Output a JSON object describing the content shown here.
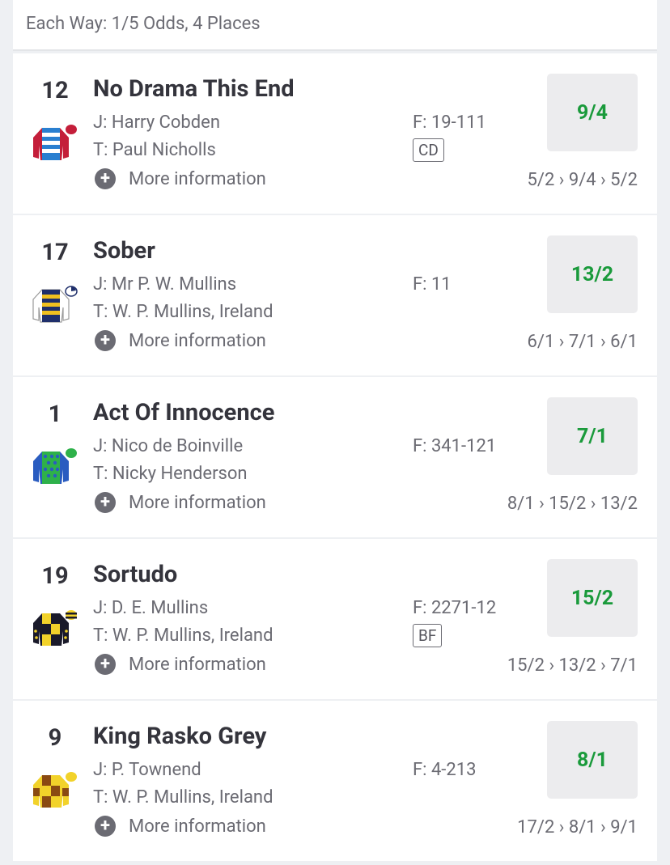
{
  "header": {
    "text": "Each Way: 1/5 Odds, 4 Places"
  },
  "runners": [
    {
      "number": "12",
      "name": "No Drama This End",
      "jockey": "J: Harry Cobden",
      "trainer": "T: Paul Nicholls",
      "form": "F: 19-111",
      "tag": "CD",
      "more": "More information",
      "odds": "9/4",
      "movement": "5/2 › 9/4 › 5/2"
    },
    {
      "number": "17",
      "name": "Sober",
      "jockey": "J: Mr P. W. Mullins",
      "trainer": "T: W. P. Mullins, Ireland",
      "form": "F: 11",
      "tag": "",
      "more": "More information",
      "odds": "13/2",
      "movement": "6/1 › 7/1 › 6/1"
    },
    {
      "number": "1",
      "name": "Act Of Innocence",
      "jockey": "J: Nico de Boinville",
      "trainer": "T: Nicky Henderson",
      "form": "F: 341-121",
      "tag": "",
      "more": "More information",
      "odds": "7/1",
      "movement": "8/1 › 15/2 › 13/2"
    },
    {
      "number": "19",
      "name": "Sortudo",
      "jockey": "J: D. E. Mullins",
      "trainer": "T: W. P. Mullins, Ireland",
      "form": "F: 2271-12",
      "tag": "BF",
      "more": "More information",
      "odds": "15/2",
      "movement": "15/2 › 13/2 › 7/1"
    },
    {
      "number": "9",
      "name": "King Rasko Grey",
      "jockey": "J: P. Townend",
      "trainer": "T: W. P. Mullins, Ireland",
      "form": "F: 4-213",
      "tag": "",
      "more": "More information",
      "odds": "8/1",
      "movement": "17/2 › 8/1 › 9/1"
    }
  ],
  "colors": {
    "odds_text": "#1a9a3b",
    "odds_bg": "#ececee"
  },
  "icons": {
    "more": "plus-circle-icon"
  }
}
